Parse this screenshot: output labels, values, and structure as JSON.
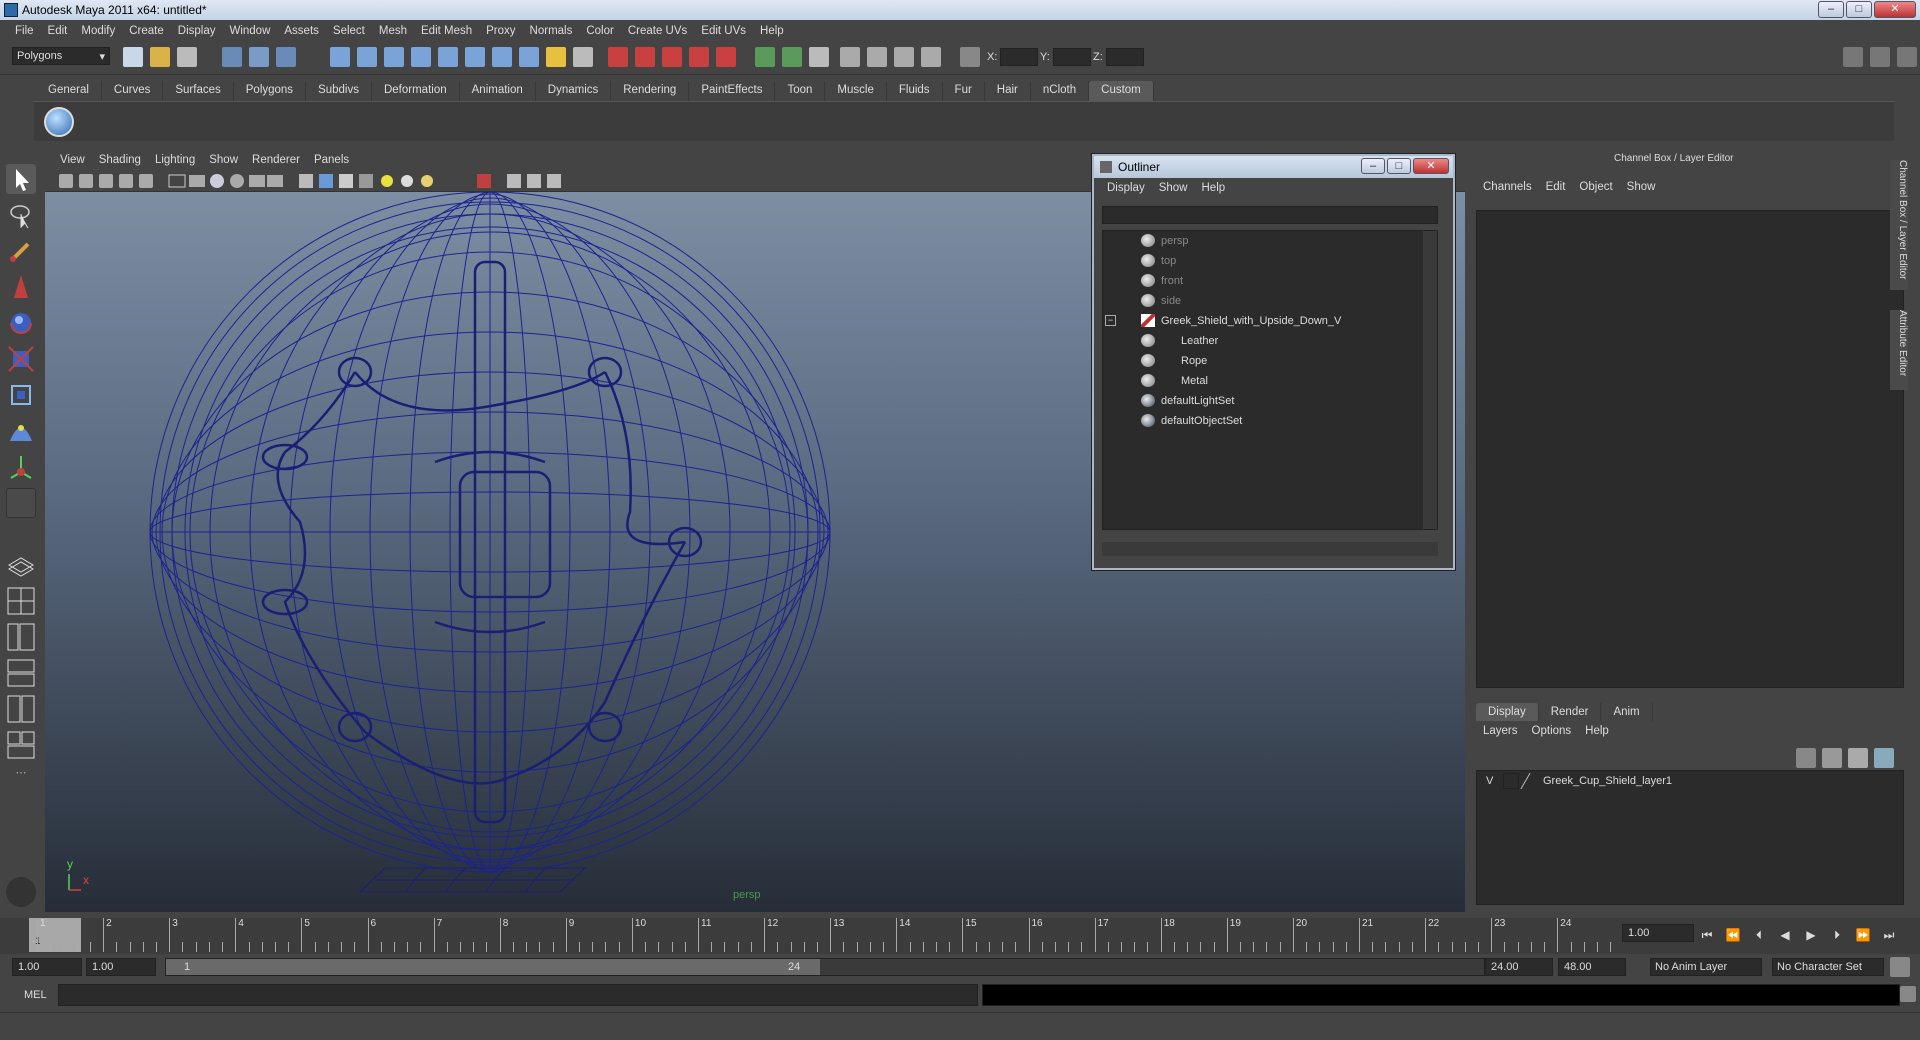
{
  "app": {
    "title": "Autodesk Maya 2011 x64: untitled*"
  },
  "menubar": [
    "File",
    "Edit",
    "Modify",
    "Create",
    "Display",
    "Window",
    "Assets",
    "Select",
    "Mesh",
    "Edit Mesh",
    "Proxy",
    "Normals",
    "Color",
    "Create UVs",
    "Edit UVs",
    "Help"
  ],
  "statusline": {
    "menuset": "Polygons",
    "x_label": "X:",
    "y_label": "Y:",
    "z_label": "Z:"
  },
  "shelf": {
    "tabs": [
      "General",
      "Curves",
      "Surfaces",
      "Polygons",
      "Subdivs",
      "Deformation",
      "Animation",
      "Dynamics",
      "Rendering",
      "PaintEffects",
      "Toon",
      "Muscle",
      "Fluids",
      "Fur",
      "Hair",
      "nCloth",
      "Custom"
    ],
    "active": "Custom"
  },
  "viewport": {
    "menu": [
      "View",
      "Shading",
      "Lighting",
      "Show",
      "Renderer",
      "Panels"
    ],
    "camera_label": "persp",
    "axis_x": "x",
    "axis_y": "y"
  },
  "outliner": {
    "title": "Outliner",
    "menu": [
      "Display",
      "Show",
      "Help"
    ],
    "items": [
      "persp",
      "top",
      "front",
      "side",
      "Greek_Shield_with_Upside_Down_V",
      "Leather",
      "Rope",
      "Metal",
      "defaultLightSet",
      "defaultObjectSet"
    ]
  },
  "channelbox": {
    "title": "Channel Box / Layer Editor",
    "menu": [
      "Channels",
      "Edit",
      "Object",
      "Show"
    ],
    "side_tabs": [
      "Channel Box / Layer Editor",
      "Attribute Editor"
    ],
    "layer_tabs": [
      "Display",
      "Render",
      "Anim"
    ],
    "layer_menu": [
      "Layers",
      "Options",
      "Help"
    ],
    "layer": {
      "visible": "V",
      "name": "Greek_Cup_Shield_layer1"
    }
  },
  "timeline": {
    "ticks": [
      "1",
      "2",
      "3",
      "4",
      "5",
      "6",
      "7",
      "8",
      "9",
      "10",
      "11",
      "12",
      "13",
      "14",
      "15",
      "16",
      "17",
      "18",
      "19",
      "20",
      "21",
      "22",
      "23",
      "24"
    ],
    "current_frame_label": "1",
    "current_time": "1.00"
  },
  "range": {
    "start": "1.00",
    "range_start": "1.00",
    "slider_start": "1",
    "slider_end": "24",
    "range_end": "24.00",
    "end": "48.00",
    "anim_layer": "No Anim Layer",
    "char_set": "No Character Set"
  },
  "cmdline": {
    "label": "MEL"
  }
}
